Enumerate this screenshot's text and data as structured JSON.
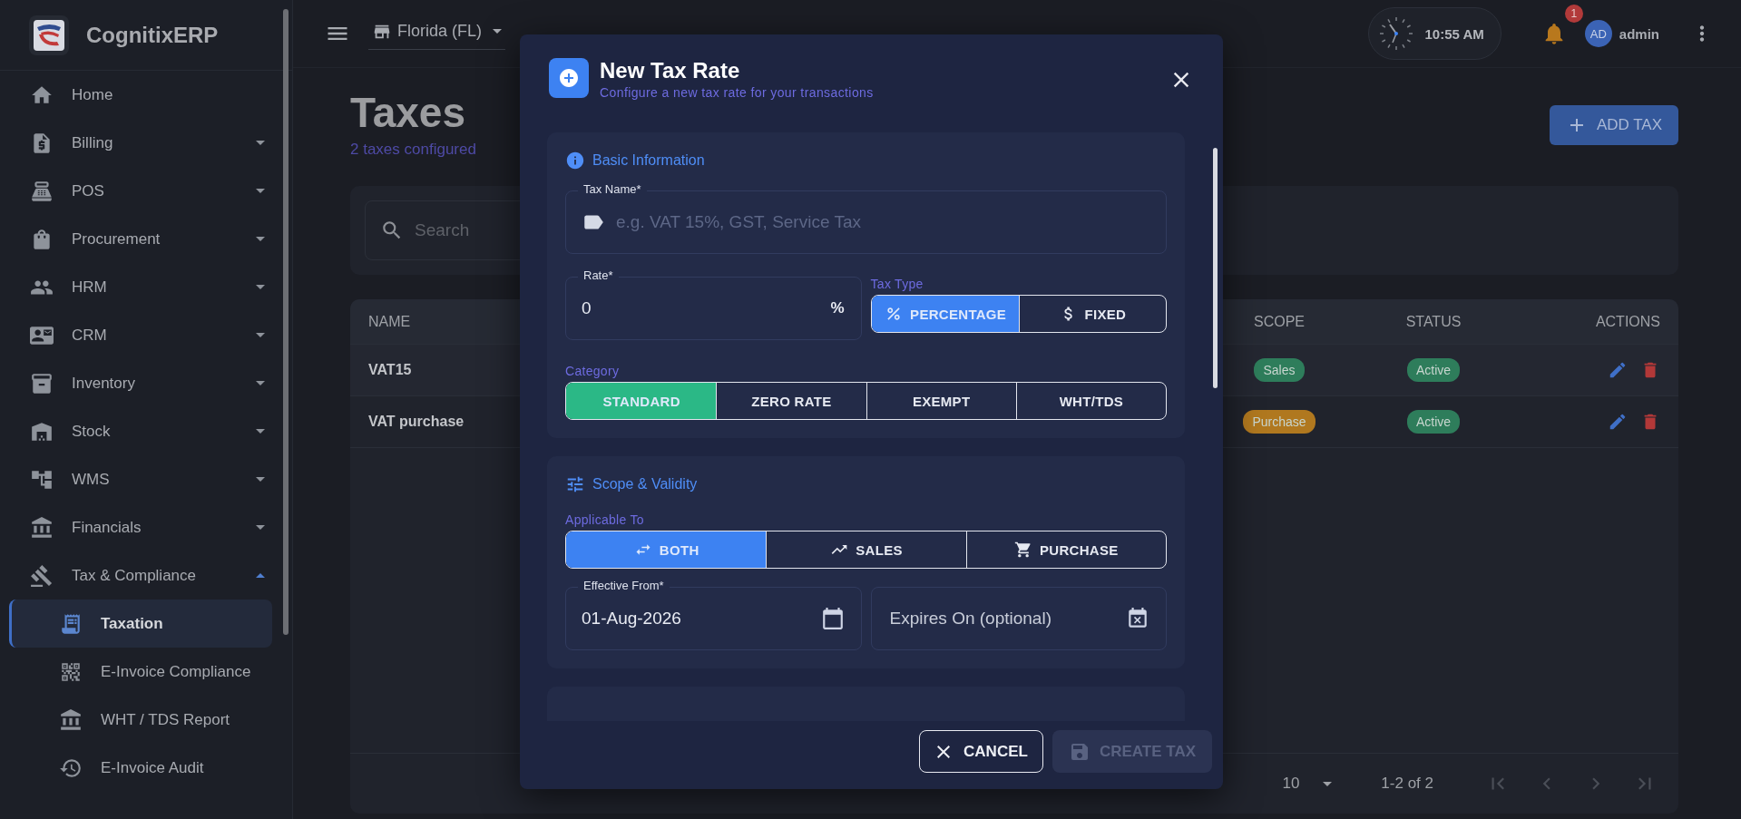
{
  "brand": {
    "name": "CognitixERP"
  },
  "sidebar": {
    "items": [
      {
        "label": "Home",
        "kind": "link",
        "selected": false
      },
      {
        "label": "Billing",
        "kind": "group",
        "expanded": false,
        "selected": false
      },
      {
        "label": "POS",
        "kind": "group",
        "expanded": false,
        "selected": false
      },
      {
        "label": "Procurement",
        "kind": "group",
        "expanded": false,
        "selected": false
      },
      {
        "label": "HRM",
        "kind": "group",
        "expanded": false,
        "selected": false
      },
      {
        "label": "CRM",
        "kind": "group",
        "expanded": false,
        "selected": false
      },
      {
        "label": "Inventory",
        "kind": "group",
        "expanded": false,
        "selected": false
      },
      {
        "label": "Stock",
        "kind": "group",
        "expanded": false,
        "selected": false
      },
      {
        "label": "WMS",
        "kind": "group",
        "expanded": false,
        "selected": false
      },
      {
        "label": "Financials",
        "kind": "group",
        "expanded": false,
        "selected": false
      },
      {
        "label": "Tax & Compliance",
        "kind": "group",
        "expanded": true,
        "selected": false,
        "children": [
          {
            "label": "Taxation",
            "selected": true
          },
          {
            "label": "E-Invoice Compliance",
            "selected": false
          },
          {
            "label": "WHT / TDS Report",
            "selected": false
          },
          {
            "label": "E-Invoice Audit",
            "selected": false
          }
        ]
      }
    ]
  },
  "topbar": {
    "store": "Florida (FL)",
    "time": "10:55 AM",
    "notifications": "1",
    "avatar": "AD",
    "user": "admin"
  },
  "page": {
    "title": "Taxes",
    "subtitle": "2 taxes configured",
    "add_button": "ADD TAX",
    "search": {
      "placeholder": "Search"
    }
  },
  "table": {
    "columns": [
      "NAME",
      "SCOPE",
      "STATUS",
      "ACTIONS"
    ],
    "rows": [
      {
        "name": "VAT15",
        "scope": {
          "text": "Sales",
          "color": "#2e7d5b"
        },
        "status": {
          "text": "Active",
          "color": "#2e7d5b"
        }
      },
      {
        "name": "VAT purchase",
        "scope": {
          "text": "Purchase",
          "color": "#b0781f"
        },
        "status": {
          "text": "Active",
          "color": "#2e7d5b"
        }
      }
    ],
    "pagination": {
      "rows_per_page": "10",
      "range": "1-2 of 2"
    }
  },
  "modal": {
    "title": "New Tax Rate",
    "subtitle": "Configure a new tax rate for your transactions",
    "basic": {
      "heading": "Basic Information",
      "tax_name": {
        "label": "Tax Name*",
        "placeholder": "e.g. VAT 15%, GST, Service Tax"
      },
      "rate": {
        "label": "Rate*",
        "value": "0",
        "suffix": "%"
      },
      "tax_type": {
        "label": "Tax Type",
        "options": [
          {
            "label": "PERCENTAGE",
            "selected": true
          },
          {
            "label": "FIXED",
            "selected": false
          }
        ]
      },
      "category": {
        "label": "Category",
        "options": [
          {
            "label": "STANDARD",
            "selected": true
          },
          {
            "label": "ZERO RATE",
            "selected": false
          },
          {
            "label": "EXEMPT",
            "selected": false
          },
          {
            "label": "WHT/TDS",
            "selected": false
          }
        ]
      }
    },
    "scope": {
      "heading": "Scope & Validity",
      "applicable_to": {
        "label": "Applicable To",
        "options": [
          {
            "label": "BOTH",
            "selected": true
          },
          {
            "label": "SALES",
            "selected": false
          },
          {
            "label": "PURCHASE",
            "selected": false
          }
        ]
      },
      "effective_from": {
        "label": "Effective From*",
        "value": "01-Aug-2026"
      },
      "expires_on": {
        "placeholder": "Expires On (optional)"
      }
    },
    "footer": {
      "cancel": "CANCEL",
      "create": "CREATE TAX",
      "create_disabled": true
    }
  }
}
